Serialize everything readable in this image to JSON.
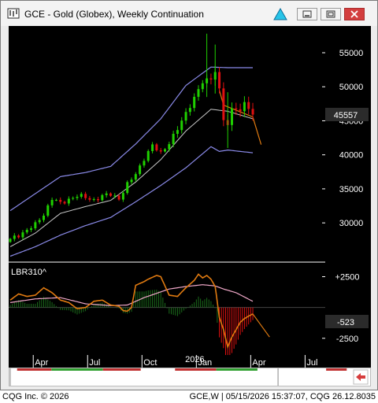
{
  "window": {
    "title": "GCE - Gold (Globex), Weekly Continuation",
    "icons": {
      "app": "chart-app-icon",
      "alert": "alert-triangle-icon",
      "minimize": "minimize-icon",
      "maximize": "maximize-icon",
      "close": "close-icon",
      "scroll": "scroll-arrow-icon"
    }
  },
  "colors": {
    "background": "#000000",
    "up_bar": "#1fd000",
    "down_bar": "#e01010",
    "upper_band": "#8a8ae8",
    "middle_band": "#c8c8c8",
    "lower_band": "#8a8ae8",
    "osc_fast": "#e07a10",
    "osc_slow": "#f0a8c8",
    "histogram": "#1a6a1a",
    "selection_red": "#c03030",
    "selection_green": "#30a030"
  },
  "chart_data": [
    {
      "type": "candlestick",
      "title": "",
      "price_labels": [
        "55000",
        "50000",
        "45000",
        "40000",
        "35000",
        "30000"
      ],
      "price_levels": [
        55000,
        50000,
        45000,
        40000,
        35000,
        30000
      ],
      "last_price": "45557",
      "ylim": [
        24700,
        58700
      ],
      "grid": false,
      "x_labels": [
        {
          "label": "Apr",
          "week": 5.5
        },
        {
          "label": "Jul",
          "week": 18.5
        },
        {
          "label": "Oct",
          "week": 31.5
        },
        {
          "label": "Jan",
          "week": 44.5
        },
        {
          "label": "Apr",
          "week": 57.5
        },
        {
          "label": "Jul",
          "week": 70.5
        }
      ],
      "year_label": "2026",
      "year_label_week": 44.5,
      "x_range": [
        0,
        74
      ],
      "anchors": {
        "close": [
          [
            0,
            27500
          ],
          [
            3,
            28600
          ],
          [
            6,
            29700
          ],
          [
            8,
            31300
          ],
          [
            10,
            33600
          ],
          [
            12,
            32800
          ],
          [
            14,
            33500
          ],
          [
            16,
            34000
          ],
          [
            18,
            33700
          ],
          [
            20,
            33400
          ],
          [
            22,
            33900
          ],
          [
            24,
            34200
          ],
          [
            26,
            33600
          ],
          [
            28,
            35600
          ],
          [
            30,
            37200
          ],
          [
            32,
            39500
          ],
          [
            34,
            41300
          ],
          [
            36,
            40300
          ],
          [
            38,
            41800
          ],
          [
            40,
            43700
          ],
          [
            42,
            46200
          ],
          [
            44,
            48400
          ],
          [
            46,
            50600
          ],
          [
            48,
            51300
          ],
          [
            49,
            52400
          ],
          [
            50,
            49500
          ],
          [
            51,
            45200
          ],
          [
            52,
            44200
          ],
          [
            53,
            46700
          ],
          [
            54,
            47100
          ],
          [
            55,
            46300
          ],
          [
            56,
            47700
          ],
          [
            57,
            46800
          ],
          [
            58,
            45557
          ]
        ],
        "upper": [
          [
            0,
            31800
          ],
          [
            6,
            34300
          ],
          [
            12,
            36800
          ],
          [
            18,
            37400
          ],
          [
            24,
            38300
          ],
          [
            30,
            41600
          ],
          [
            36,
            45300
          ],
          [
            42,
            50200
          ],
          [
            48,
            52900
          ],
          [
            52,
            52800
          ],
          [
            58,
            52800
          ]
        ],
        "middle": [
          [
            0,
            26500
          ],
          [
            6,
            28500
          ],
          [
            12,
            31400
          ],
          [
            18,
            32400
          ],
          [
            24,
            33300
          ],
          [
            30,
            36000
          ],
          [
            36,
            39300
          ],
          [
            42,
            43500
          ],
          [
            48,
            46700
          ],
          [
            52,
            46400
          ],
          [
            58,
            45300
          ]
        ],
        "lower": [
          [
            0,
            25100
          ],
          [
            6,
            26500
          ],
          [
            12,
            28200
          ],
          [
            18,
            29600
          ],
          [
            24,
            30800
          ],
          [
            30,
            33100
          ],
          [
            36,
            35500
          ],
          [
            42,
            38100
          ],
          [
            48,
            41200
          ],
          [
            50,
            40500
          ],
          [
            52,
            40700
          ],
          [
            58,
            40300
          ]
        ],
        "projection": [
          [
            50,
            49500
          ],
          [
            51,
            47300
          ],
          [
            58,
            45557
          ],
          [
            60,
            41500
          ]
        ]
      }
    },
    {
      "type": "line",
      "title": "LBR310^",
      "value_labels": [
        "+2500",
        "-2500"
      ],
      "value_levels": [
        2500,
        -2500
      ],
      "last_value": "-523",
      "ylim": [
        -3600,
        3300
      ],
      "zero_line": 0,
      "anchors": {
        "fast": [
          [
            0,
            600
          ],
          [
            2,
            1100
          ],
          [
            4,
            900
          ],
          [
            6,
            1000
          ],
          [
            8,
            1600
          ],
          [
            10,
            1200
          ],
          [
            12,
            600
          ],
          [
            14,
            400
          ],
          [
            16,
            -100
          ],
          [
            18,
            0
          ],
          [
            20,
            500
          ],
          [
            22,
            600
          ],
          [
            24,
            200
          ],
          [
            26,
            100
          ],
          [
            27,
            -250
          ],
          [
            28,
            -300
          ],
          [
            29,
            0
          ],
          [
            30,
            1800
          ],
          [
            32,
            2100
          ],
          [
            33,
            2300
          ],
          [
            35,
            2600
          ],
          [
            36,
            2500
          ],
          [
            38,
            1000
          ],
          [
            40,
            900
          ],
          [
            42,
            1600
          ],
          [
            44,
            2200
          ],
          [
            45,
            2700
          ],
          [
            46,
            2400
          ],
          [
            47,
            2600
          ],
          [
            48,
            2300
          ],
          [
            49,
            1700
          ],
          [
            50,
            -800
          ],
          [
            51,
            -1800
          ],
          [
            52,
            -3200
          ],
          [
            53,
            -2400
          ],
          [
            55,
            -1200
          ],
          [
            56,
            -900
          ],
          [
            57,
            -700
          ],
          [
            58,
            -523
          ]
        ],
        "slow": [
          [
            0,
            400
          ],
          [
            6,
            700
          ],
          [
            12,
            800
          ],
          [
            18,
            300
          ],
          [
            24,
            150
          ],
          [
            28,
            200
          ],
          [
            32,
            800
          ],
          [
            38,
            1500
          ],
          [
            42,
            1700
          ],
          [
            46,
            1850
          ],
          [
            49,
            1750
          ],
          [
            51,
            1500
          ],
          [
            54,
            1200
          ],
          [
            58,
            500
          ]
        ],
        "projection": [
          [
            58,
            -523
          ],
          [
            62,
            -2400
          ]
        ]
      }
    }
  ],
  "scroll": {
    "window_start": 0.0,
    "window_end": 0.78
  },
  "status": {
    "left": "CQG Inc. © 2026",
    "right": "GCE,W | 05/15/2026 15:37:07, CQG 26.12.8035"
  }
}
